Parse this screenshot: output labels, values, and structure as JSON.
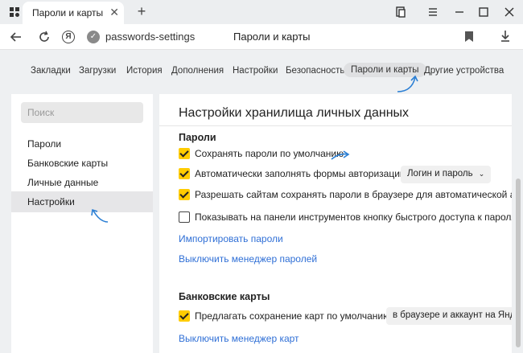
{
  "browser": {
    "tab_title": "Пароли и карты",
    "address": "passwords-settings",
    "page_title": "Пароли и карты",
    "new_tab_symbol": "+",
    "close_symbol": "✕"
  },
  "nav": {
    "tabs": [
      {
        "label": "Закладки"
      },
      {
        "label": "Загрузки"
      },
      {
        "label": "История"
      },
      {
        "label": "Дополнения"
      },
      {
        "label": "Настройки"
      },
      {
        "label": "Безопасность"
      },
      {
        "label": "Пароли и карты",
        "active": true
      },
      {
        "label": "Другие устройства"
      }
    ]
  },
  "sidebar": {
    "search_placeholder": "Поиск",
    "items": [
      {
        "label": "Пароли"
      },
      {
        "label": "Банковские карты"
      },
      {
        "label": "Личные данные"
      },
      {
        "label": "Настройки",
        "active": true
      }
    ]
  },
  "main": {
    "title": "Настройки хранилища личных данных",
    "passwords": {
      "title": "Пароли",
      "options": [
        {
          "label": "Сохранять пароли по умолчанию",
          "checked": true
        },
        {
          "label": "Автоматически заполнять формы авторизации",
          "checked": true,
          "dropdown": "Логин и пароль"
        },
        {
          "label": "Разрешать сайтам сохранять пароли в браузере для автоматической автор",
          "checked": true
        },
        {
          "label": "Показывать на панели инструментов кнопку быстрого доступа к паролям",
          "checked": false
        }
      ],
      "import_link": "Импортировать пароли",
      "disable_link": "Выключить менеджер паролей"
    },
    "cards": {
      "title": "Банковские карты",
      "options": [
        {
          "label": "Предлагать сохранение карт по умолчанию",
          "checked": true,
          "dropdown": "в браузере и аккаунт на Янде"
        }
      ],
      "disable_link": "Выключить менеджер карт"
    }
  },
  "colors": {
    "accent": "#ffcc00",
    "link": "#2f6fd6",
    "annotation_arrow": "#2b7fd4"
  }
}
